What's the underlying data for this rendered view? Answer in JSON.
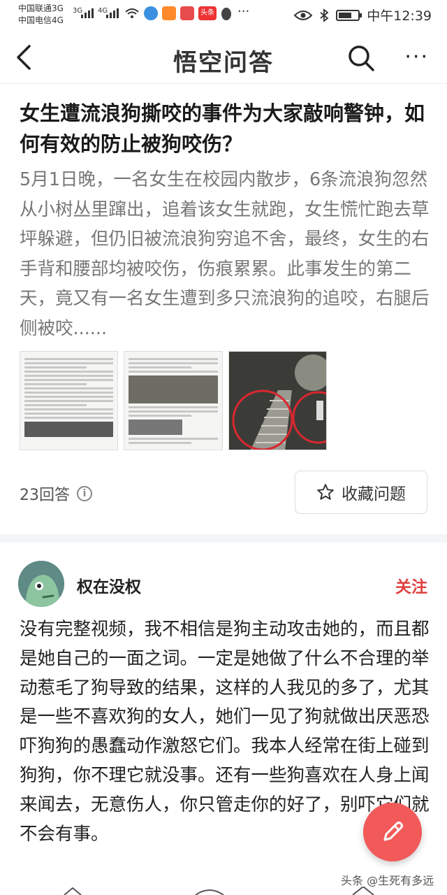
{
  "status_bar": {
    "carrier1": "中国联通3G",
    "carrier2": "中国电信4G",
    "sig1_tag": "3G",
    "sig2_tag": "4G",
    "app_badge": "头条",
    "time": "中午12:39",
    "more": "···"
  },
  "nav": {
    "title": "悟空问答",
    "more": "···"
  },
  "question": {
    "title": "女生遭流浪狗撕咬的事件为大家敲响警钟，如何有效的防止被狗咬伤？",
    "description": "5月1日晚，一名女生在校园内散步，6条流浪狗忽然从小树丛里蹿出，追着该女生就跑，女生慌忙跑去草坪躲避，但仍旧被流浪狗穷追不舍，最终，女生的右手背和腰部均被咬伤，伤痕累累。此事发生的第二天，竟又有一名女生遭到多只流浪狗的追咬，右腿后侧被咬......",
    "answer_count": "23回答",
    "favorite_label": "收藏问题"
  },
  "answer": {
    "author": "权在没权",
    "follow_label": "关注",
    "text": "没有完整视频，我不相信是狗主动攻击她的，而且都是她自己的一面之词。一定是她做了什么不合理的举动惹毛了狗导致的结果，这样的人我见的多了，尤其是一些不喜欢狗的女人，她们一见了狗就做出厌恶恐吓狗狗的愚蠢动作激怒它们。我本人经常在街上碰到狗狗，你不理它就没事。还有一些狗喜欢在人身上闻来闻去，无意伤人，你只管走你的好了，别吓它们就不会有事。"
  },
  "watermark": "头条 @生死有多远",
  "colors": {
    "accent_red": "#e04040",
    "fab": "#f25a5a",
    "text_main": "#222222",
    "text_muted": "#777777"
  }
}
